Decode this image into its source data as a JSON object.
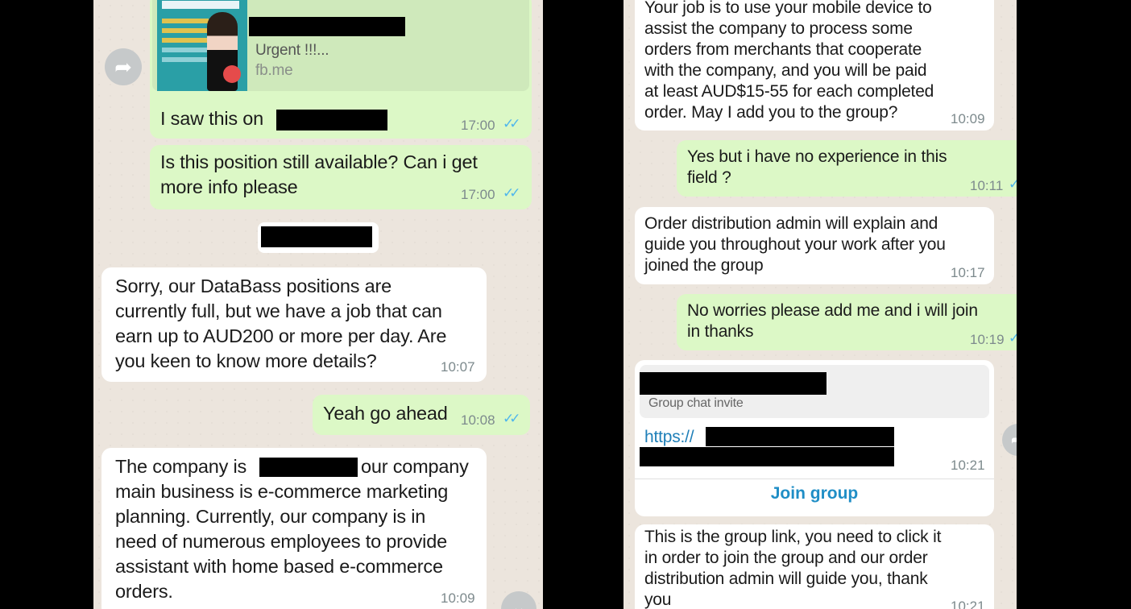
{
  "left_chat": {
    "link_preview": {
      "subtitle": "Urgent !!!...",
      "domain": "fb.me",
      "thumbnail_icon": "job-ad-thumbnail"
    },
    "msg_saw": {
      "text": "I saw this on",
      "time": "17:00"
    },
    "msg_available": {
      "text": "Is this position still available? Can i get\nmore info please",
      "time": "17:00"
    },
    "msg_sorry": {
      "text": "Sorry, our DataBass positions are\ncurrently full, but we have a job that can\nearn up to AUD200 or more per day. Are\nyou keen to know more details?",
      "time": "10:07"
    },
    "msg_ahead": {
      "text": "Yeah go ahead",
      "time": "10:08"
    },
    "msg_company": {
      "line1_a": "The company is",
      "line1_b": "our company",
      "rest": "main business is e-commerce marketing\nplanning. Currently, our company is in\nneed of numerous employees to provide\nassistant with home based e-commerce\norders.",
      "time": "10:09"
    }
  },
  "right_chat": {
    "msg_job": {
      "text": "Your job is to use your mobile device to\nassist the company to process some\norders from merchants that cooperate\nwith the company, and you will be paid\nat least AUD$15-55 for each completed\norder. May I add you to the group?",
      "time": "10:09"
    },
    "msg_yes": {
      "text": "Yes but i have no experience in this\nfield ?",
      "time": "10:11"
    },
    "msg_order_admin": {
      "text": "Order distribution admin will explain and\nguide you throughout your work after you\njoined the group",
      "time": "10:17"
    },
    "msg_no_worries": {
      "text": "No worries please add me and i will join\nin thanks",
      "time": "10:19"
    },
    "invite": {
      "label": "Group chat invite",
      "link_prefix": "https://",
      "time": "10:21",
      "join_label": "Join group"
    },
    "msg_group_link": {
      "text": "This is the group link, you need to click it\nin order to join the group and our order\ndistribution admin will guide you, thank\nyou",
      "time": "10:21"
    }
  },
  "colors": {
    "incoming": "#ffffff",
    "outgoing": "#dcf8c6",
    "tick": "#4fb6ec",
    "link": "#1f8ec6",
    "background": "#ece5dd"
  },
  "icons": {
    "forward": "forward-icon",
    "read_receipt": "double-check-icon"
  }
}
